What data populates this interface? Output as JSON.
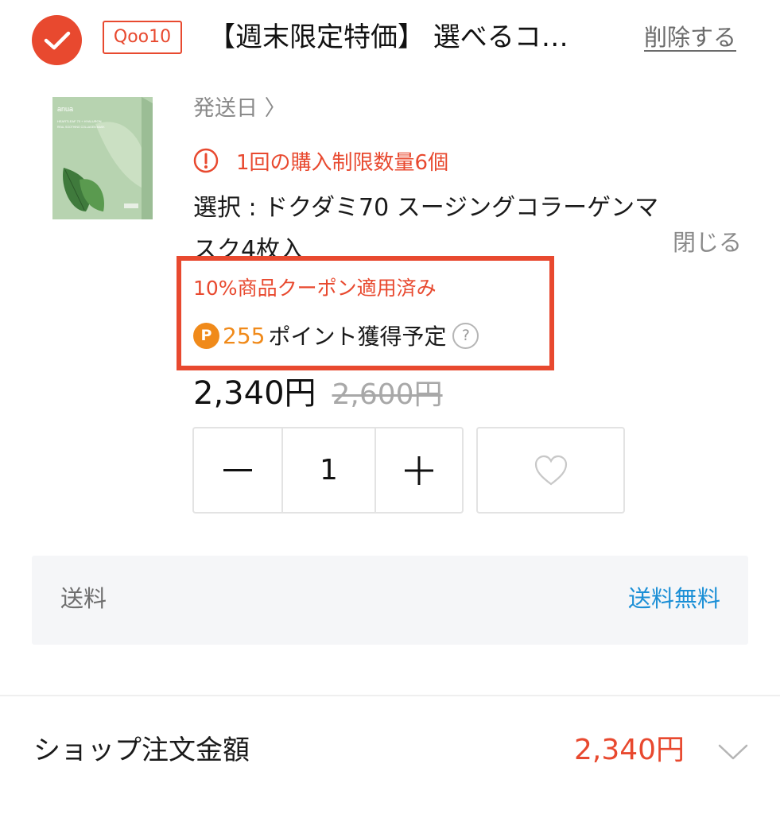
{
  "colors": {
    "accent_red": "#e8492f",
    "points_orange": "#f08a1a",
    "link_blue": "#1b8fd6",
    "muted_gray": "#8a8a8a",
    "panel_bg": "#f5f6f8"
  },
  "item": {
    "selected": true,
    "shop_badge": "Qoo10",
    "title": "【週末限定特価】 選べるコ…",
    "delete_label": "削除する",
    "ship_date_label": "発送日 〉",
    "purchase_limit": "1回の購入制限数量6個",
    "option_text": "選択 : ドクダミ70 スージングコラーゲンマスク4枚入",
    "close_label": "閉じる",
    "coupon_text": "10%商品クーポン適用済み",
    "points_icon": "P",
    "points_value": "255",
    "points_label": "ポイント獲得予定",
    "help_icon": "?",
    "price_now": "2,340円",
    "price_old": "2,600円",
    "quantity": "1",
    "product_image": {
      "brand": "anua",
      "line1": "HEARTLEAF 70 + HYALURON",
      "line2": "REAL SOOTHING COLLAGEN MASK"
    },
    "icons": {
      "check": "check-icon",
      "warning": "exclamation-circle-icon",
      "minus": "minus-icon",
      "plus": "plus-icon",
      "wishlist": "heart-icon",
      "expand": "chevron-down-icon"
    }
  },
  "shipping": {
    "label": "送料",
    "value": "送料無料"
  },
  "order_total": {
    "label": "ショップ注文金額",
    "amount": "2,340円"
  }
}
